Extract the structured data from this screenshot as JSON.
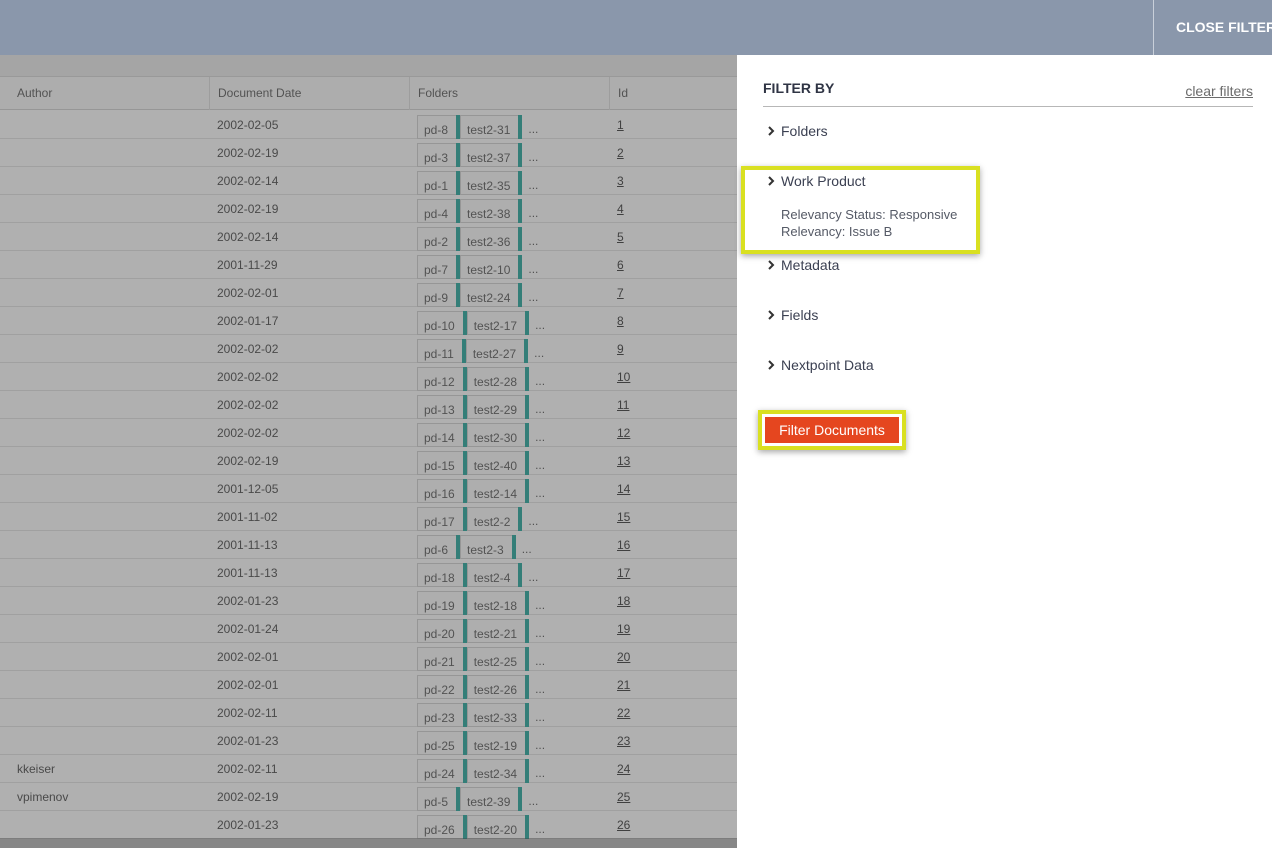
{
  "header": {
    "close_filters_label": "CLOSE FILTERS"
  },
  "grid": {
    "columns": {
      "author": "Author",
      "document_date": "Document Date",
      "folders": "Folders",
      "id": "Id"
    },
    "rows": [
      {
        "author": "",
        "date": "2002-02-05",
        "folder1": "pd-8",
        "folder2": "test2-31",
        "more": "...",
        "id": "1"
      },
      {
        "author": "",
        "date": "2002-02-19",
        "folder1": "pd-3",
        "folder2": "test2-37",
        "more": "...",
        "id": "2"
      },
      {
        "author": "",
        "date": "2002-02-14",
        "folder1": "pd-1",
        "folder2": "test2-35",
        "more": "...",
        "id": "3"
      },
      {
        "author": "",
        "date": "2002-02-19",
        "folder1": "pd-4",
        "folder2": "test2-38",
        "more": "...",
        "id": "4"
      },
      {
        "author": "",
        "date": "2002-02-14",
        "folder1": "pd-2",
        "folder2": "test2-36",
        "more": "...",
        "id": "5"
      },
      {
        "author": "",
        "date": "2001-11-29",
        "folder1": "pd-7",
        "folder2": "test2-10",
        "more": "...",
        "id": "6"
      },
      {
        "author": "",
        "date": "2002-02-01",
        "folder1": "pd-9",
        "folder2": "test2-24",
        "more": "...",
        "id": "7"
      },
      {
        "author": "",
        "date": "2002-01-17",
        "folder1": "pd-10",
        "folder2": "test2-17",
        "more": "...",
        "id": "8"
      },
      {
        "author": "",
        "date": "2002-02-02",
        "folder1": "pd-11",
        "folder2": "test2-27",
        "more": "...",
        "id": "9"
      },
      {
        "author": "",
        "date": "2002-02-02",
        "folder1": "pd-12",
        "folder2": "test2-28",
        "more": "...",
        "id": "10"
      },
      {
        "author": "",
        "date": "2002-02-02",
        "folder1": "pd-13",
        "folder2": "test2-29",
        "more": "...",
        "id": "11"
      },
      {
        "author": "",
        "date": "2002-02-02",
        "folder1": "pd-14",
        "folder2": "test2-30",
        "more": "...",
        "id": "12"
      },
      {
        "author": "",
        "date": "2002-02-19",
        "folder1": "pd-15",
        "folder2": "test2-40",
        "more": "...",
        "id": "13"
      },
      {
        "author": "",
        "date": "2001-12-05",
        "folder1": "pd-16",
        "folder2": "test2-14",
        "more": "...",
        "id": "14"
      },
      {
        "author": "",
        "date": "2001-11-02",
        "folder1": "pd-17",
        "folder2": "test2-2",
        "more": "...",
        "id": "15"
      },
      {
        "author": "",
        "date": "2001-11-13",
        "folder1": "pd-6",
        "folder2": "test2-3",
        "more": "...",
        "id": "16"
      },
      {
        "author": "",
        "date": "2001-11-13",
        "folder1": "pd-18",
        "folder2": "test2-4",
        "more": "...",
        "id": "17"
      },
      {
        "author": "",
        "date": "2002-01-23",
        "folder1": "pd-19",
        "folder2": "test2-18",
        "more": "...",
        "id": "18"
      },
      {
        "author": "",
        "date": "2002-01-24",
        "folder1": "pd-20",
        "folder2": "test2-21",
        "more": "...",
        "id": "19"
      },
      {
        "author": "",
        "date": "2002-02-01",
        "folder1": "pd-21",
        "folder2": "test2-25",
        "more": "...",
        "id": "20"
      },
      {
        "author": "",
        "date": "2002-02-01",
        "folder1": "pd-22",
        "folder2": "test2-26",
        "more": "...",
        "id": "21"
      },
      {
        "author": "",
        "date": "2002-02-11",
        "folder1": "pd-23",
        "folder2": "test2-33",
        "more": "...",
        "id": "22"
      },
      {
        "author": "",
        "date": "2002-01-23",
        "folder1": "pd-25",
        "folder2": "test2-19",
        "more": "...",
        "id": "23"
      },
      {
        "author": "kkeiser",
        "date": "2002-02-11",
        "folder1": "pd-24",
        "folder2": "test2-34",
        "more": "...",
        "id": "24"
      },
      {
        "author": "vpimenov",
        "date": "2002-02-19",
        "folder1": "pd-5",
        "folder2": "test2-39",
        "more": "...",
        "id": "25"
      },
      {
        "author": "",
        "date": "2002-01-23",
        "folder1": "pd-26",
        "folder2": "test2-20",
        "more": "...",
        "id": "26"
      }
    ]
  },
  "filter_panel": {
    "title": "FILTER BY",
    "clear_label": "clear filters",
    "sections": [
      {
        "label": "Folders",
        "icon": "chevron-right-icon"
      },
      {
        "label": "Work Product",
        "icon": "chevron-right-icon"
      },
      {
        "label": "Metadata",
        "icon": "chevron-right-icon"
      },
      {
        "label": "Fields",
        "icon": "chevron-right-icon"
      },
      {
        "label": "Nextpoint Data",
        "icon": "chevron-right-icon"
      }
    ],
    "work_product_applied": [
      "Relevancy Status: Responsive",
      "Relevancy: Issue B"
    ],
    "submit_label": "Filter Documents"
  },
  "colors": {
    "header_bg": "#8a97ab",
    "accent_tag": "#1ea59a",
    "button": "#e5461f",
    "highlight": "#d9e021"
  }
}
